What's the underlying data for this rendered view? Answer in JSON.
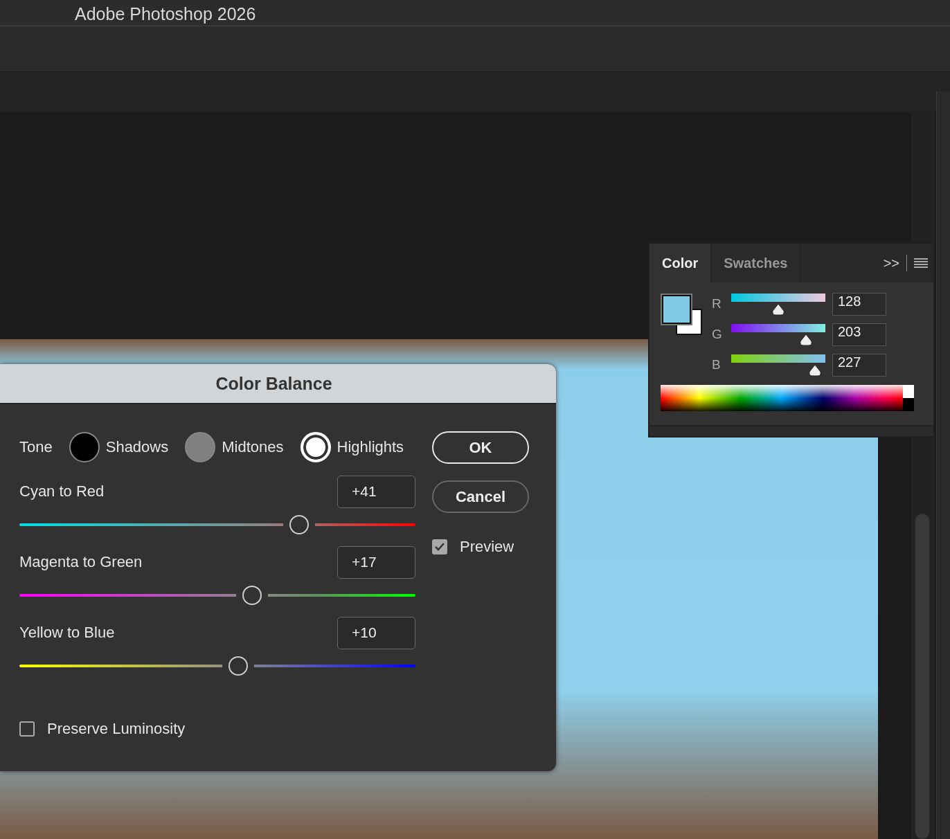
{
  "app": {
    "title": "Adobe Photoshop 2026"
  },
  "color_balance": {
    "title": "Color Balance",
    "tone_label": "Tone",
    "tones": [
      {
        "label": "Shadows",
        "selected": false,
        "color": "#000000"
      },
      {
        "label": "Midtones",
        "selected": false,
        "color": "#808080"
      },
      {
        "label": "Highlights",
        "selected": true,
        "color": "#ffffff"
      }
    ],
    "sliders": [
      {
        "label": "Cyan to Red",
        "value": "+41",
        "level": 0.705
      },
      {
        "label": "Magenta to Green",
        "value": "+17",
        "level": 0.585
      },
      {
        "label": "Yellow to Blue",
        "value": "+10",
        "level": 0.55
      }
    ],
    "buttons": [
      {
        "label": "OK",
        "default": true
      },
      {
        "label": "Cancel",
        "default": false
      }
    ],
    "preview": {
      "label": "Preview",
      "checked": true
    },
    "preserve_luminosity": {
      "label": "Preserve Luminosity",
      "checked": false
    }
  },
  "color_panel": {
    "tabs": [
      {
        "label": "Color",
        "selected": true
      },
      {
        "label": "Swatches",
        "selected": false
      }
    ],
    "expand_glyph": ">>",
    "channels": [
      {
        "label": "R",
        "value": "128",
        "level": 0.502
      },
      {
        "label": "G",
        "value": "203",
        "level": 0.796
      },
      {
        "label": "B",
        "value": "227",
        "level": 0.89
      }
    ]
  }
}
